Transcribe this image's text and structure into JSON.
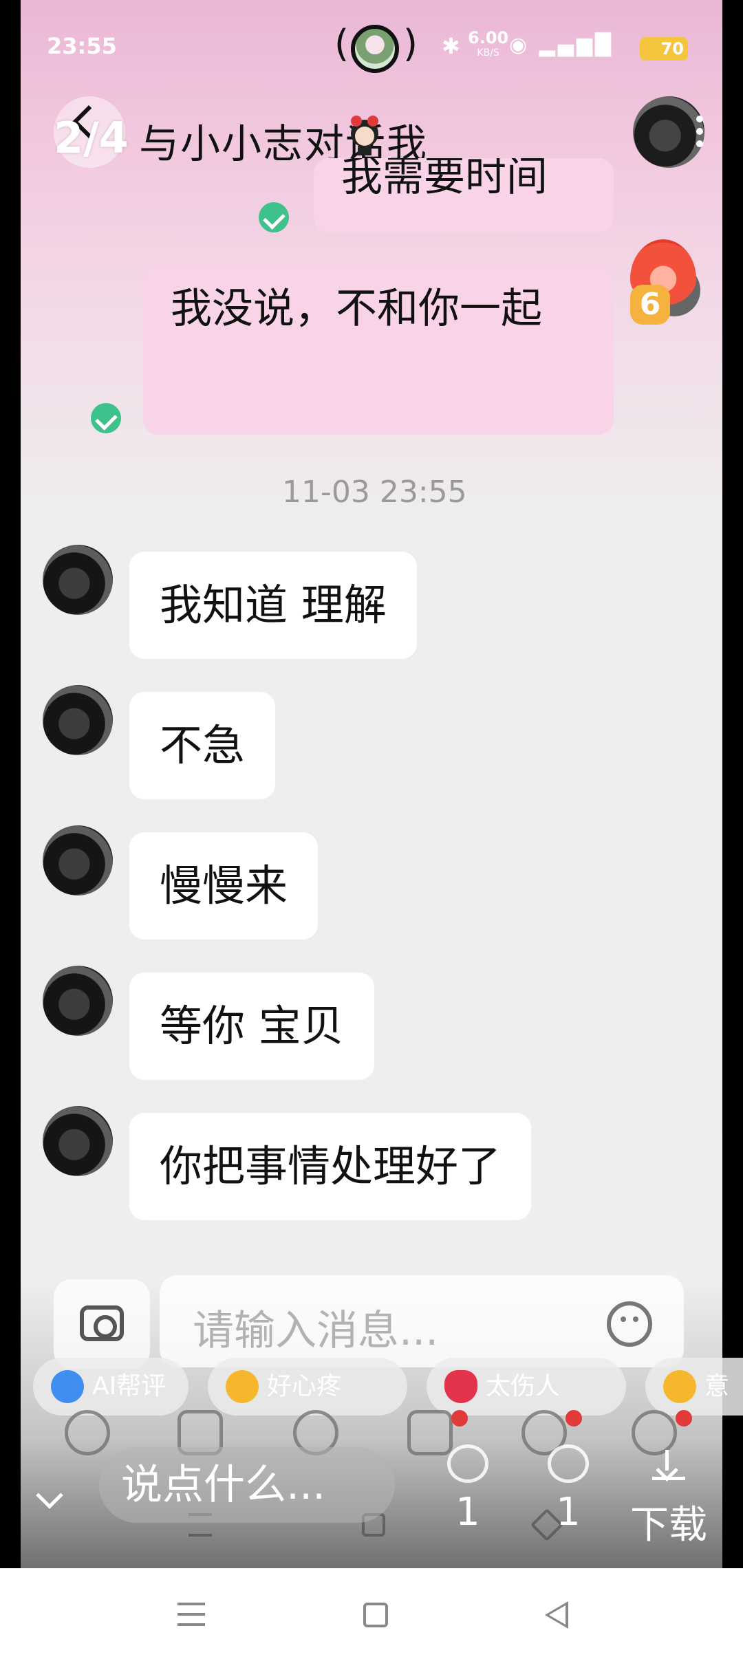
{
  "status_bar": {
    "time": "23:55",
    "net_speed": "6.00",
    "net_unit": "KB/S",
    "signal": "5G 4G",
    "battery": "70"
  },
  "header": {
    "page_indicator": "2/4",
    "title": "与小小志对话",
    "title_suffix": "我"
  },
  "sent_messages": [
    {
      "text": "我需要时间"
    },
    {
      "text": "我没说，不和你一起"
    }
  ],
  "fire_badge": {
    "count": "6"
  },
  "timestamp": "11-03 23:55",
  "received_messages": [
    {
      "text": "我知道 理解"
    },
    {
      "text": "不急"
    },
    {
      "text": "慢慢来"
    },
    {
      "text": "等你 宝贝"
    },
    {
      "text": "你把事情处理好了"
    }
  ],
  "input": {
    "placeholder": "请输入消息..."
  },
  "chips": [
    {
      "label": "AI帮评",
      "icon": "ai-icon",
      "color": "#3f8ef0"
    },
    {
      "label": "好心疼",
      "icon": "crying-face-icon",
      "color": "#f6b72f"
    },
    {
      "label": "太伤人",
      "icon": "broken-heart-icon",
      "color": "#e3334a"
    },
    {
      "label": "意",
      "icon": "sad-face-icon",
      "color": "#f6b72f"
    }
  ],
  "overlay": {
    "comment_placeholder": "说点什么...",
    "likes": "1",
    "comments": "1",
    "download_label": "下载"
  }
}
